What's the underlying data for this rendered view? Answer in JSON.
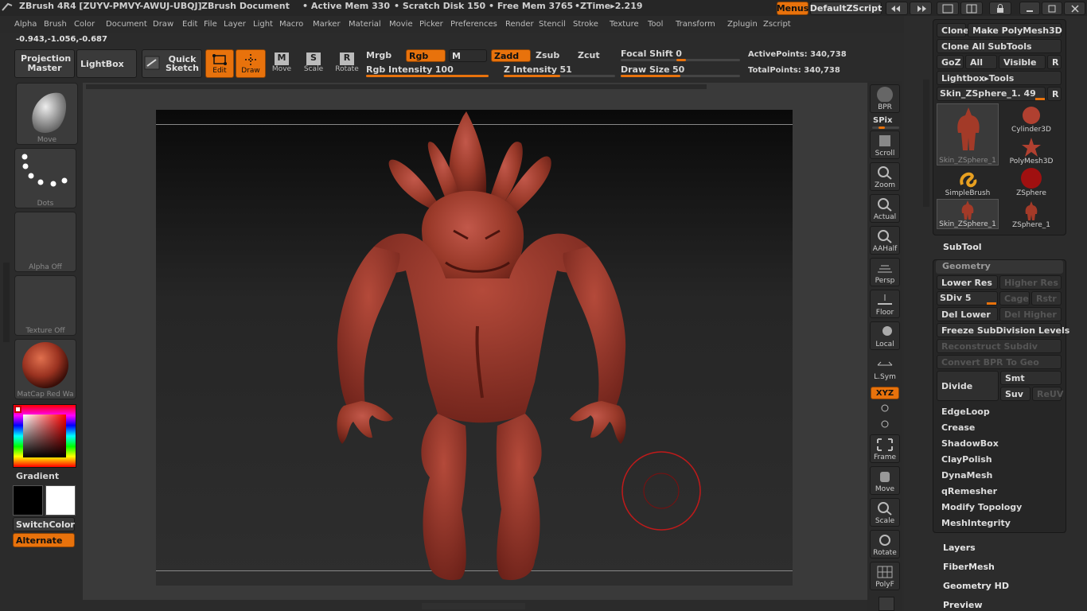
{
  "titlebar": {
    "app_title": "ZBrush 4R4 [ZUYV-PMVY-AWUJ-UBQJ]",
    "document": "ZBrush Document",
    "active_mem": "• Active Mem 330",
    "scratch_disk": "• Scratch Disk 150",
    "free_mem": "• Free Mem 3765",
    "ztime": "•ZTime▸2.219",
    "menus_label": "Menus",
    "zscript_label": "DefaultZScript"
  },
  "menubar": {
    "items": [
      "Alpha",
      "Brush",
      "Color",
      "Document",
      "Draw",
      "Edit",
      "File",
      "Layer",
      "Light",
      "Macro",
      "Marker",
      "Material",
      "Movie",
      "Picker",
      "Preferences",
      "Render",
      "Stencil",
      "Stroke",
      "Texture",
      "Tool",
      "Transform",
      "Zplugin",
      "Zscript"
    ]
  },
  "coords": "-0.943,-1.056,-0.687",
  "toolbar": {
    "projection_master": "Projection Master",
    "lightbox": "LightBox",
    "quick_sketch": "Quick Sketch",
    "edit": "Edit",
    "draw": "Draw",
    "move": "Move",
    "scale": "Scale",
    "rotate": "Rotate",
    "mrgb": "Mrgb",
    "rgb": "Rgb",
    "m": "M",
    "zadd": "Zadd",
    "zsub": "Zsub",
    "zcut": "Zcut",
    "rgb_intensity_label": "Rgb Intensity",
    "rgb_intensity": "100",
    "z_intensity_label": "Z Intensity",
    "z_intensity": "51",
    "focal_shift_label": "Focal Shift",
    "focal_shift": "0",
    "draw_size_label": "Draw Size",
    "draw_size": "50",
    "active_points": "ActivePoints: 340,738",
    "total_points": "TotalPoints: 340,738"
  },
  "leftshelf": {
    "brush": "Move",
    "stroke": "Dots",
    "alpha": "Alpha  Off",
    "texture": "Texture  Off",
    "material": "MatCap  Red  Wa",
    "gradient": "Gradient",
    "switch_color": "SwitchColor",
    "alternate": "Alternate"
  },
  "righttools": {
    "bpr": "BPR",
    "spix": "SPix",
    "scroll": "Scroll",
    "zoom": "Zoom",
    "actual": "Actual",
    "aahalf": "AAHalf",
    "persp": "Persp",
    "floor": "Floor",
    "local": "Local",
    "lsym": "L.Sym",
    "xyz": "XYZ",
    "frame": "Frame",
    "move": "Move",
    "scale": "Scale",
    "rotate": "Rotate",
    "polyf": "PolyF"
  },
  "toolpanel": {
    "clone": "Clone",
    "make_polymesh": "Make PolyMesh3D",
    "clone_all": "Clone All SubTools",
    "goz": "GoZ",
    "all": "All",
    "visible": "Visible",
    "r": "R",
    "lightbox_tools": "Lightbox▸Tools",
    "current_tool": "Skin_ZSphere_1. 49",
    "subtools": [
      "Skin_ZSphere_1",
      "Cylinder3D",
      "PolyMesh3D",
      "SimpleBrush",
      "ZSphere",
      "Skin_ZSphere_1",
      "ZSphere_1"
    ],
    "subtool_section": "SubTool",
    "geometry_section": "Geometry",
    "lower_res": "Lower Res",
    "higher_res": "Higher Res",
    "sdiv": "SDiv 5",
    "cage": "Cage",
    "rstr": "Rstr",
    "del_lower": "Del Lower",
    "del_higher": "Del Higher",
    "freeze": "Freeze SubDivision Levels",
    "reconstruct": "Reconstruct Subdiv",
    "convert_bpr": "Convert BPR To Geo",
    "divide": "Divide",
    "smt": "Smt",
    "suv": "Suv",
    "reuv": "ReUV",
    "edgeloop": "EdgeLoop",
    "crease": "Crease",
    "shadowbox": "ShadowBox",
    "claypolish": "ClayPolish",
    "dynamesh": "DynaMesh",
    "qremesher": "qRemesher",
    "modify_topology": "Modify Topology",
    "meshintegrity": "MeshIntegrity",
    "layers": "Layers",
    "fibermesh": "FiberMesh",
    "geometry_hd": "Geometry HD",
    "preview": "Preview"
  },
  "colors": {
    "accent": "#e8720c",
    "model": "#9a3a2a",
    "background": "#2b2b2b"
  },
  "sliders": {
    "rgb_intensity": 100,
    "z_intensity": 51,
    "focal_shift": 0,
    "draw_size_fraction": 0.5,
    "sdiv_fraction": 1.0
  }
}
